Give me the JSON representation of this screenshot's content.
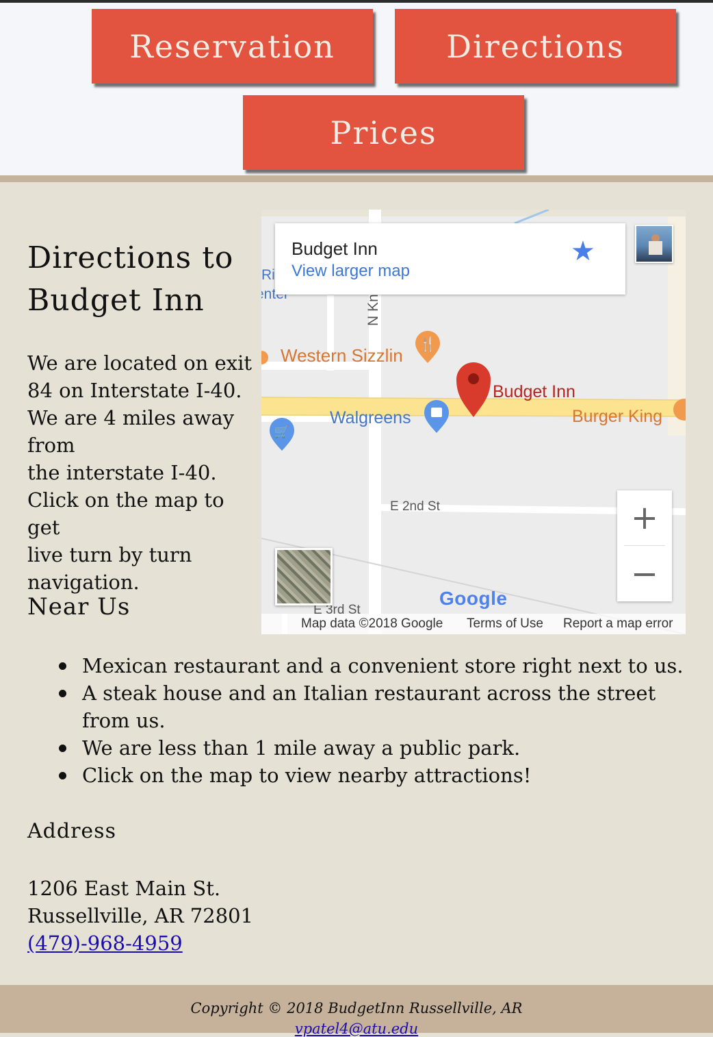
{
  "nav": {
    "reservation": "Reservation",
    "directions": "Directions",
    "prices": "Prices"
  },
  "colors": {
    "button": "#e25440",
    "page_bg": "#e5e2d5",
    "footer": "#c6b29b",
    "link": "#1a0dab"
  },
  "main": {
    "title": "Directions to Budget Inn",
    "intro_lines": [
      "We are located on exit",
      "84 on Interstate I-40.",
      "We are 4 miles away",
      "from",
      "the interstate I-40.",
      "Click on the map to get",
      "live turn by turn",
      "navigation."
    ],
    "near_title": "Near Us",
    "near_items": [
      "Mexican restaurant and a convenient store right next to us.",
      "A steak house and an Italian restaurant across the street from us.",
      "We are less than 1 mile away a public park.",
      "Click on the map to view nearby attractions!"
    ],
    "address_title": "Address",
    "address_lines": [
      "1206 East Main St.",
      "Russellville, AR 72801"
    ],
    "phone": "(479)-968-4959"
  },
  "map": {
    "card_name": "Budget Inn",
    "card_link": "View larger map",
    "places": {
      "western_sizzlin": "Western Sizzlin",
      "budget_inn": "Budget Inn",
      "walgreens": "Walgreens",
      "burger_king": "Burger King",
      "e2nd": "E 2nd St",
      "e3rd": "E 3rd St",
      "nkn": "N Kn",
      "partial_riv": "Riv",
      "partial_enter": "enter"
    },
    "google": "Google",
    "map_data": "Map data ©2018 Google",
    "terms": "Terms of Use",
    "report": "Report a map error",
    "zoom_in": "+",
    "zoom_out": "−"
  },
  "footer": {
    "copyright": "Copyright © 2018 BudgetInn Russellville, AR",
    "email": "vpatel4@atu.edu"
  }
}
